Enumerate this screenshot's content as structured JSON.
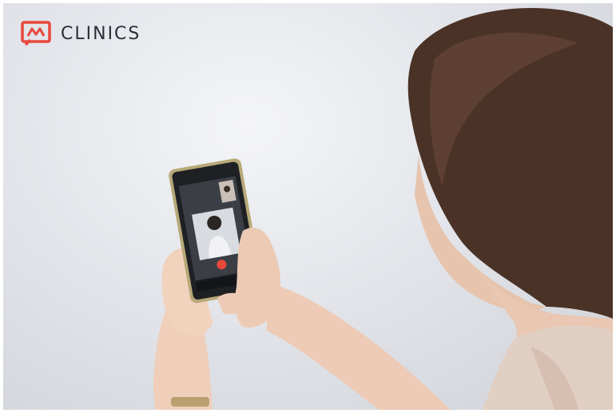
{
  "brand": {
    "name": "CLINICS",
    "accent_color": "#e8473b",
    "logo_icon": "chat-bubble-m-logo-icon"
  },
  "phone_screen": {
    "call_state": "video-call",
    "end_call_icon": "phone-hangup-icon",
    "chat_icon": "chat-icon",
    "nav_icons": [
      "back-icon",
      "home-icon",
      "recents-icon"
    ]
  }
}
